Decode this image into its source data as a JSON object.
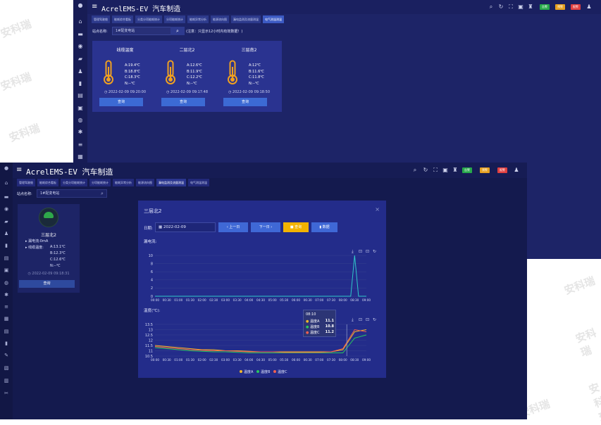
{
  "watermark": "安科瑞",
  "back": {
    "app_title": "AcrelEMS-EV 汽车制造",
    "tabs": [
      "管理驾驶舱",
      "能耗综合看板",
      "分类分项能耗统计",
      "分项能耗统计",
      "能耗异常分析",
      "能源流向图",
      "漏电监测及流量测温",
      "电气测温测温"
    ],
    "active_tab": 7,
    "site_label": "站点名称:",
    "site_value": "1#配变电站",
    "notice": "(注意：只显示12小时内有效数据！)",
    "cards": [
      {
        "name": "线缆温度",
        "a": "A:19.4℃",
        "b": "B:18.8℃",
        "c": "C:18.3℃",
        "n": "N:--℃",
        "time": "2022-02-09 09:20:00",
        "btn": "查询"
      },
      {
        "name": "二层北2",
        "a": "A:12.6℃",
        "b": "B:11.9℃",
        "c": "C:12.2℃",
        "n": "N:--℃",
        "time": "2022-02-09 09:17:48",
        "btn": "查询"
      },
      {
        "name": "三层南2",
        "a": "A:12℃",
        "b": "B:11.6℃",
        "c": "C:11.8℃",
        "n": "N:--℃",
        "time": "2022-02-09 09:18:50",
        "btn": "查询"
      }
    ],
    "badges": [
      {
        "label": "告警",
        "color": "#27a84a"
      },
      {
        "label": "预警",
        "color": "#e6a020"
      },
      {
        "label": "报警",
        "color": "#e04040"
      }
    ]
  },
  "front": {
    "app_title": "AcrelEMS-EV 汽车制造",
    "tabs": [
      "管理驾驶舱",
      "能耗综合看板",
      "分类分项能耗统计",
      "分项能耗统计",
      "能耗异常分析",
      "能源流向图",
      "漏电监测及流量测温",
      "电气测温测温"
    ],
    "active_tab": 6,
    "site_label": "站点名称:",
    "site_value": "1#配变电站",
    "card": {
      "name": "三层北2",
      "leak": "漏电流:0mA",
      "line_temp": "线缆温度:",
      "a": "A:13.1℃",
      "b": "B:12.3℃",
      "c": "C:12.6℃",
      "n": "N:--℃",
      "time": "2022-02-09 09:18:31",
      "btn": "查询"
    },
    "badges": [
      {
        "label": "告警",
        "color": "#27a84a"
      },
      {
        "label": "预警",
        "color": "#e6a020"
      },
      {
        "label": "报警",
        "color": "#e04040"
      }
    ]
  },
  "modal": {
    "title": "三层北2",
    "date_label": "日期:",
    "date_value": "2022-02-09",
    "prev_btn": "上一日",
    "next_btn": "下一日",
    "query_btn": "查询",
    "data_btn": "数据",
    "close": "×"
  },
  "chart_data": [
    {
      "type": "line",
      "title": "漏电流:",
      "x": [
        "00:00",
        "00:30",
        "01:00",
        "01:30",
        "02:00",
        "02:30",
        "03:00",
        "03:30",
        "04:00",
        "04:30",
        "05:00",
        "05:30",
        "06:00",
        "06:30",
        "07:00",
        "07:30",
        "08:00",
        "08:30",
        "09:00"
      ],
      "ylim": [
        0,
        10
      ],
      "yticks": [
        0,
        2,
        4,
        6,
        8,
        10
      ],
      "series": [
        {
          "values": [
            0,
            0,
            0,
            0,
            0,
            0,
            0,
            0,
            0,
            0,
            0,
            0,
            0,
            0,
            0,
            0,
            0,
            0,
            0
          ],
          "spike": {
            "from": "08:20",
            "peak_at": "08:30",
            "peak": 10,
            "to": "08:40"
          },
          "color": "#2fc7c9"
        }
      ]
    },
    {
      "type": "line",
      "title": "温度(℃):",
      "x": [
        "00:00",
        "00:30",
        "01:00",
        "01:30",
        "02:00",
        "02:30",
        "03:00",
        "03:30",
        "04:00",
        "04:30",
        "05:00",
        "05:30",
        "06:00",
        "06:30",
        "07:00",
        "07:30",
        "08:00",
        "08:30",
        "09:00"
      ],
      "ylim": [
        10.5,
        13.5
      ],
      "yticks": [
        10.5,
        11,
        11.5,
        12,
        12.5,
        13,
        13.5
      ],
      "series": [
        {
          "name": "温度A",
          "color": "#f2b62a",
          "values": [
            11.5,
            11.4,
            11.3,
            11.2,
            11.1,
            11.1,
            11.0,
            11.0,
            10.95,
            10.9,
            10.9,
            10.9,
            10.9,
            10.9,
            10.9,
            10.9,
            11.1,
            12.8,
            13.0
          ]
        },
        {
          "name": "温度B",
          "color": "#28c55e",
          "values": [
            11.3,
            11.2,
            11.1,
            11.0,
            10.95,
            10.9,
            10.9,
            10.85,
            10.8,
            10.8,
            10.8,
            10.8,
            10.8,
            10.8,
            10.8,
            10.8,
            10.8,
            12.2,
            12.5
          ]
        },
        {
          "name": "温度C",
          "color": "#f06050",
          "values": [
            11.4,
            11.3,
            11.2,
            11.1,
            11.05,
            11.0,
            11.0,
            10.95,
            10.9,
            10.9,
            10.9,
            10.85,
            10.85,
            10.85,
            10.85,
            10.9,
            11.2,
            13.0,
            12.8
          ]
        }
      ],
      "tooltip": {
        "time": "08:10",
        "rows": [
          {
            "name": "温度A",
            "value": "11.1"
          },
          {
            "name": "温度B",
            "value": "10.8"
          },
          {
            "name": "温度C",
            "value": "11.2"
          }
        ]
      }
    }
  ]
}
